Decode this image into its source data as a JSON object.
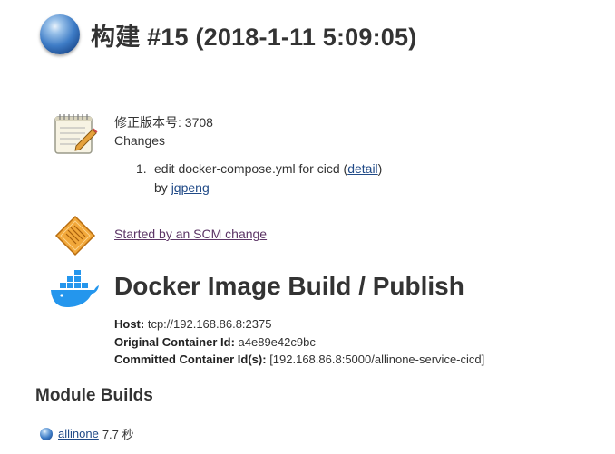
{
  "build": {
    "title": "构建 #15 (2018-1-11 5:09:05)"
  },
  "changes": {
    "revision_label": "修正版本号",
    "revision": "3708",
    "heading": "Changes",
    "items": [
      {
        "number": "1.",
        "message": "edit docker-compose.yml for cicd",
        "detail_label": "detail",
        "by_label": "by",
        "author": "jqpeng"
      }
    ]
  },
  "cause": {
    "text": "Started by an SCM change"
  },
  "docker": {
    "title": "Docker Image Build / Publish",
    "host_label": "Host:",
    "host": "tcp://192.168.86.8:2375",
    "original_label": "Original Container Id:",
    "original": "a4e89e42c9bc",
    "committed_label": "Committed Container Id(s):",
    "committed": "[192.168.86.8:5000/allinone-service-cicd]"
  },
  "modules": {
    "heading": "Module Builds",
    "items": [
      {
        "name": "allinone",
        "duration": "7.7 秒"
      }
    ]
  },
  "colors": {
    "status_blue": "#3e7cc6",
    "link": "#204a87",
    "visited_link": "#5c3566",
    "docker_blue": "#2496ed"
  }
}
